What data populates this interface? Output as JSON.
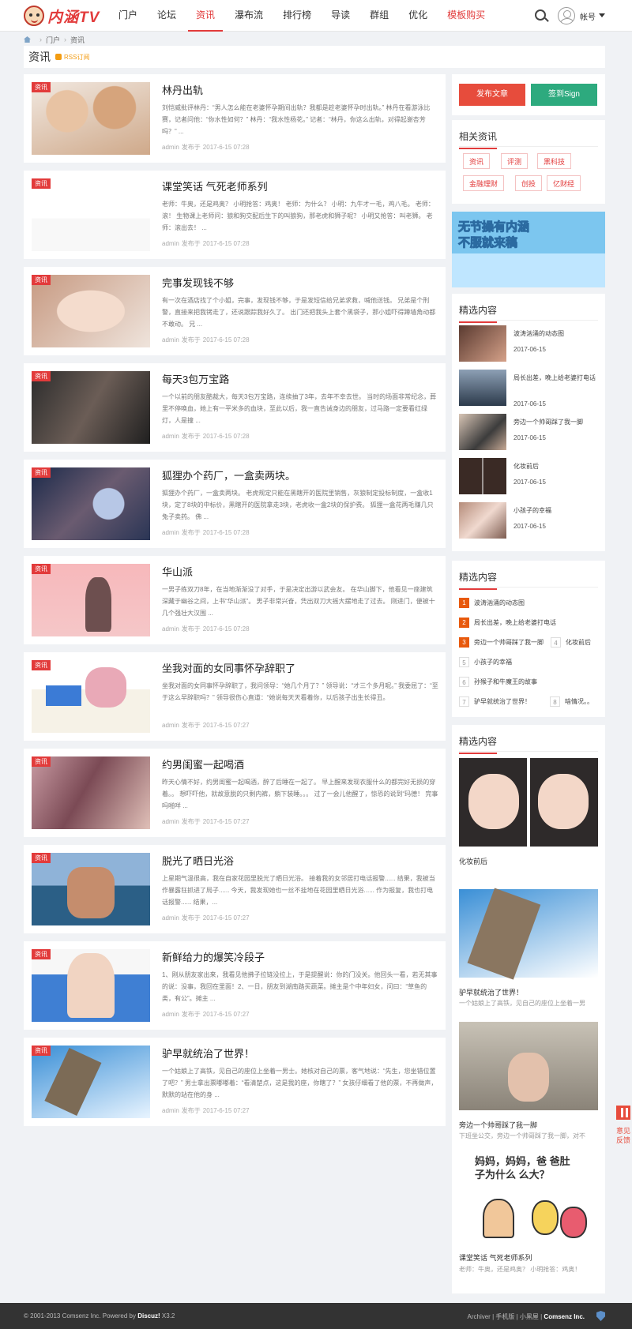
{
  "header": {
    "logo_text": "内涵TV",
    "nav": [
      "门户",
      "论坛",
      "资讯",
      "瀑布流",
      "排行榜",
      "导读",
      "群组",
      "优化",
      "模板购买"
    ],
    "account": "帐号"
  },
  "breadcrumb": [
    "门户",
    "资讯"
  ],
  "section": {
    "title": "资讯",
    "rss": "RSS订阅"
  },
  "articles": [
    {
      "tag": "资讯",
      "title": "林丹出轨",
      "summary": "刘恺威批评林丹：“男人怎么能在老婆怀孕期间出轨？我都是趁老婆怀孕时出轨。” 林丹在看游泳比赛，记者问他：“你水性如何？” 林丹：“我水性杨花。” 记者：“林丹，你这么出轨，对得起谢杏芳吗？” ...",
      "author": "admin",
      "verb": "发布于",
      "date": "2017-6-15 07:28"
    },
    {
      "tag": "资讯",
      "title": "课堂笑话 气死老师系列",
      "summary": "老师：牛奥，还是鸡奥？ 小明抢答：鸡奥！ 老师：为什么？ 小明：九牛才一毛，鸡八毛。 老师：滚！ 生物课上老师问：狼和狗交配后生下的叫狼狗，那老虎和狮子呢？ 小明又抢答：叫老狮。 老师：滚出去！ ...",
      "author": "admin",
      "verb": "发布于",
      "date": "2017-6-15 07:28"
    },
    {
      "tag": "资讯",
      "title": "完事发现钱不够",
      "summary": "有一次在酒店找了个小姐，完事，发现钱不够，于是发短信给兄弟求救，喊他送钱。 兄弟是个刑警，直接来把我铐走了，还说跟踪我好久了。 出门还把我头上套个黑袋子，那小姐吓得蹲墙角动都不敢动。 兄 ...",
      "author": "admin",
      "verb": "发布于",
      "date": "2017-6-15 07:28"
    },
    {
      "tag": "资讯",
      "title": "每天3包万宝路",
      "summary": "一个以前的朋友酷裁大，每天3包万宝路，连续抽了3年，去年不幸去世。 当时的场面非常纪念，葬里不停唤血，她上有一平米多的血块，至此以后，我一直告诫身边的朋友，过马路一定要看红绿灯，人是撞 ...",
      "author": "admin",
      "verb": "发布于",
      "date": "2017-6-15 07:28"
    },
    {
      "tag": "资讯",
      "title": "狐狸办个药厂，一盒卖两块。",
      "summary": "狐狸办个药厂，一盒卖两块。 老虎规定只能在黑瞎开的医院里销售，灰狼制定投标制度，一盒收1块，定了8块的中标价，黑瞎开的医院拿走3块，老虎收一盒2块的保护费。 狐狸一盒花两毛赚几只兔子卖药。 佛 ...",
      "author": "admin",
      "verb": "发布于",
      "date": "2017-6-15 07:28"
    },
    {
      "tag": "资讯",
      "title": "华山派",
      "summary": "一男子练双刀8年，在当地渐渐没了对手，于是决定出游以武会友。 在华山脚下，他看见一座建筑深藏于幽谷之间，上书“华山派”。 男子非常兴奋，凭出双刀大摇大摆地走了过去。 刚进门，便被十几个强壮大汉围 ...",
      "author": "admin",
      "verb": "发布于",
      "date": "2017-6-15 07:28"
    },
    {
      "tag": "资讯",
      "title": "坐我对面的女同事怀孕辞职了",
      "summary": "坐我对面的女同事怀孕辞职了，我问领导：“她几个月了？” 领导说：“才三个多月呢。” 我委屈了：“至于这么早辞职吗？” 领导很伤心直道：“她说每天天看着你，以后孩子出生长得丑。",
      "author": "admin",
      "verb": "发布于",
      "date": "2017-6-15 07:27"
    },
    {
      "tag": "资讯",
      "title": "约男闺蜜一起喝酒",
      "summary": "昨天心情不好，约男闺蜜一起喝酒，醉了后睡在一起了。 早上醒来发现衣服什么的都完好无损的穿着。。 想吓吓他，就故意脱的只剩内裤，躺下装睡。。。 过了一会儿他醒了，惊恐的说到“玛德！ 完事吗啪咩 ...",
      "author": "admin",
      "verb": "发布于",
      "date": "2017-6-15 07:27"
    },
    {
      "tag": "资讯",
      "title": "脱光了晒日光浴",
      "summary": "上星期气温很高，我在自家花园里脱光了晒日光浴。 接着我的女邻居打电话报警...... 结果，我被当作暴露狂抓进了局子...... 今天，我发现她也一丝不挂地在花园里晒日光浴...... 作为报复，我也打电话报警...... 结果，...",
      "author": "admin",
      "verb": "发布于",
      "date": "2017-6-15 07:27"
    },
    {
      "tag": "资讯",
      "title": "新鲜给力的爆笑冷段子",
      "summary": "1、刚从朋友家出来，我看见他拂子拉链没拉上，于是提醒说：你的门没关。他回头一看，若无其事的说：没事，我回在里面！2、一日，朋友到湖南路买蔬菜。摊主是个中年妇女，问曰：“草鱼的类，有公”。摊主 ...",
      "author": "admin",
      "verb": "发布于",
      "date": "2017-6-15 07:27"
    },
    {
      "tag": "资讯",
      "title": "驴早就统治了世界！",
      "summary": "一个姑娘上了高铁，见自己的座位上坐着一男士。她核对自己的票，客气地说：“先生，您坐错位置了吧？” 男士拿出票嘟嘟着：“看清楚点，这是我的座，你瞎了？” 女孩仔细看了他的票，不再做声，默默的站在他的身 ...",
      "author": "admin",
      "verb": "发布于",
      "date": "2017-6-15 07:27"
    }
  ],
  "sidebar": {
    "post_button": "发布文章",
    "sign_button": "签到Sign",
    "related_title": "相关资讯",
    "related_tags": [
      "资讯",
      "评测",
      "黑科技",
      "金融理财",
      "创投",
      "亿财经"
    ],
    "banner": {
      "line1": "无节操有内涵",
      "line2": "不服就来稿"
    },
    "picks_title": "精选内容",
    "picks": [
      {
        "title": "波涛汹涌的动态图",
        "date": "2017-06-15"
      },
      {
        "title": "局长出差，晚上给老婆打电话",
        "date": "2017-06-15"
      },
      {
        "title": "旁边一个帅哥踩了我一脚",
        "date": "2017-06-15"
      },
      {
        "title": "化妆前后",
        "date": "2017-06-15"
      },
      {
        "title": "小孩子的幸福",
        "date": "2017-06-15"
      }
    ],
    "rank_title": "精选内容",
    "rank": [
      {
        "num": "1",
        "text": "波涛汹涌的动态图"
      },
      {
        "num": "2",
        "text": "局长出差，晚上给老婆打电话"
      },
      {
        "num": "3",
        "text": "旁边一个帅哥踩了我一脚"
      },
      {
        "num": "4",
        "text": "化妆前后"
      },
      {
        "num": "5",
        "text": "小孩子的幸福"
      },
      {
        "num": "6",
        "text": "孙猴子和牛魔王的故事"
      },
      {
        "num": "7",
        "text": "驴早就统治了世界！"
      },
      {
        "num": "8",
        "text": "啥情况。。"
      }
    ],
    "pics_title": "精选内容",
    "pics": [
      {
        "caption": "化妆前后",
        "sub": ""
      },
      {
        "caption": "驴早就统治了世界！",
        "sub": "一个姑娘上了高铁，见自己的座位上坐着一男"
      },
      {
        "caption": "旁边一个帅哥踩了我一脚",
        "sub": "下班坐公交，旁边一个帅哥踩了我一脚，对不"
      },
      {
        "caption": "课堂笑话 气死老师系列",
        "sub": "老师：牛奥，还是鸡奥？ 小明抢答：鸡奥！"
      }
    ],
    "cartoon_text": "妈妈，妈妈，爸 爸肚子为什么 么大？"
  },
  "float": {
    "feedback": "意见反馈"
  },
  "footer": {
    "copyright": "© 2001-2013 Comsenz Inc.  Powered by",
    "brand": "Discuz!",
    "version": "X3.2",
    "links": "Archiver | 手机版 | 小黑屋 |",
    "company": "Comsenz Inc."
  }
}
